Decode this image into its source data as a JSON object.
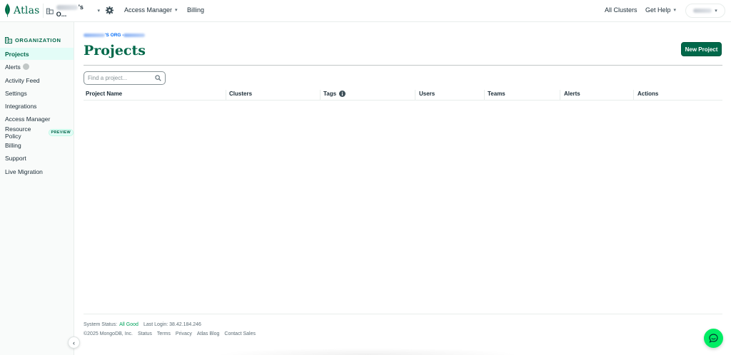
{
  "topnav": {
    "logo_text": "Atlas",
    "org_name_suffix": "'s O...",
    "access_manager": "Access Manager",
    "billing": "Billing",
    "all_clusters": "All Clusters",
    "get_help": "Get Help",
    "dropdown_glyph": "▾"
  },
  "sidebar": {
    "heading": "ORGANIZATION",
    "items": [
      {
        "label": "Projects"
      },
      {
        "label": "Alerts"
      },
      {
        "label": "Activity Feed"
      },
      {
        "label": "Settings"
      },
      {
        "label": "Integrations"
      },
      {
        "label": "Access Manager"
      },
      {
        "label": "Resource Policy",
        "badge": "PREVIEW"
      },
      {
        "label": "Billing"
      },
      {
        "label": "Support"
      },
      {
        "label": "Live Migration"
      }
    ],
    "collapse_glyph": "‹"
  },
  "main": {
    "breadcrumb_mid": "'S ORG - ",
    "title": "Projects",
    "new_project": "New Project",
    "search_placeholder": "Find a project...",
    "columns": [
      "Project Name",
      "Clusters",
      "Tags",
      "Users",
      "Teams",
      "Alerts",
      "Actions"
    ]
  },
  "footer": {
    "status_label": "System Status:",
    "status_value": "All Good",
    "last_login": "Last Login: 38.42.184.246",
    "copyright": "©2025 MongoDB, Inc.",
    "links": [
      "Status",
      "Terms",
      "Privacy",
      "Atlas Blog",
      "Contact Sales"
    ]
  },
  "colors": {
    "brand_green": "#00684a",
    "active_bg": "#e3fcf7",
    "chat_green": "#00ed64",
    "link_blue": "#016bf8"
  }
}
